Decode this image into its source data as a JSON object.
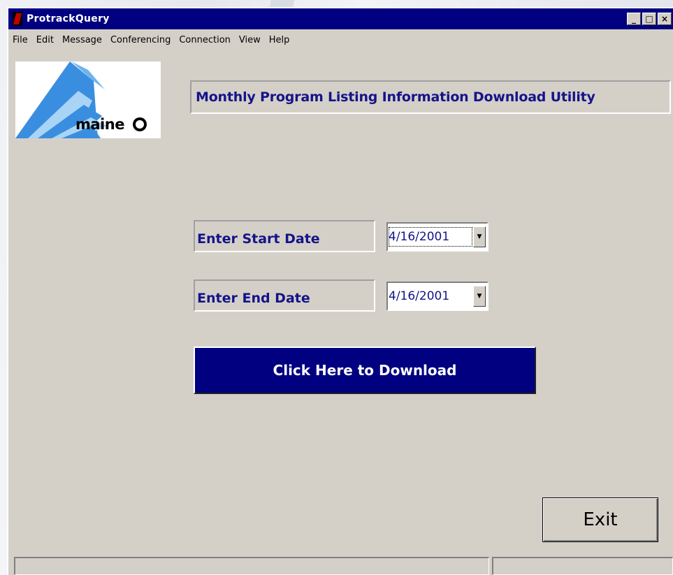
{
  "window": {
    "title": "ProtrackQuery",
    "controls": {
      "minimize": "_",
      "maximize": "□",
      "close": "×"
    }
  },
  "menu": [
    "File",
    "Edit",
    "Message",
    "Conferencing",
    "Connection",
    "View",
    "Help"
  ],
  "logo": {
    "text": "maine"
  },
  "heading": "Monthly Program Listing Information Download Utility",
  "start_date": {
    "label": "Enter Start Date",
    "value": "4/16/2001"
  },
  "end_date": {
    "label": "Enter End Date",
    "value": "4/16/2001"
  },
  "download_button": "Click Here to Download",
  "exit_button": "Exit",
  "colors": {
    "titlebar": "#000080",
    "window_face": "#d4d0c8",
    "label_text": "#14148a",
    "download_button": "#000080",
    "logo_blue": "#3a8ee0",
    "logo_light_blue": "#a9d4f5"
  },
  "icons": {
    "app": "protrack-app-icon",
    "dropdown": "chevron-down-icon"
  }
}
